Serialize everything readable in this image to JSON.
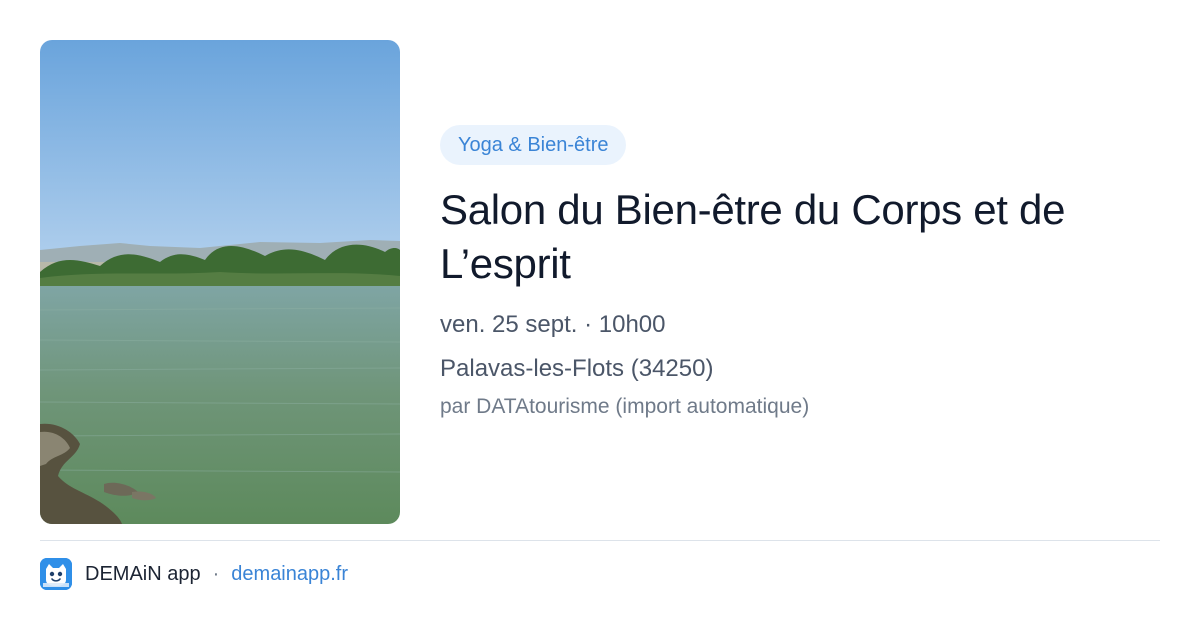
{
  "event": {
    "category": "Yoga & Bien-être",
    "title": "Salon du Bien-être du Corps et de L’esprit",
    "datetime": "ven. 25 sept. · 10h00",
    "location": "Palavas-les-Flots (34250)",
    "source": "par DATAtourisme (import automatique)"
  },
  "footer": {
    "app_name": "DEMAiN app",
    "separator": "·",
    "site": "demainapp.fr",
    "app_icon": "demain-app-logo-icon"
  },
  "colors": {
    "accent": "#3a84d6",
    "badge_bg": "#eaf3fd",
    "title": "#111a2c",
    "meta": "#4b5668"
  }
}
